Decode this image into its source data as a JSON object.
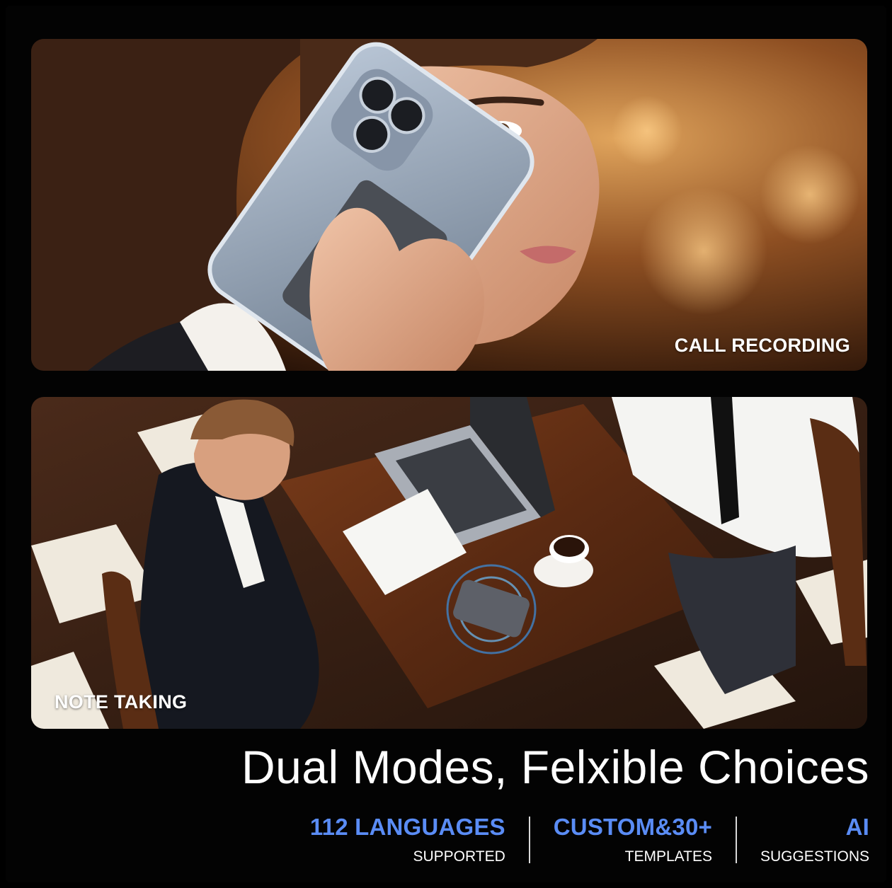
{
  "panels": {
    "top": {
      "label": "CALL RECORDING"
    },
    "bottom": {
      "label": "NOTE TAKING"
    }
  },
  "headline": "Dual Modes, Felxible Choices",
  "stats": [
    {
      "value": "112 LANGUAGES",
      "sub": "SUPPORTED"
    },
    {
      "value": "CUSTOM&30+",
      "sub": "TEMPLATES"
    },
    {
      "value": "AI",
      "sub": "SUGGESTIONS"
    }
  ],
  "colors": {
    "accent": "#5a8cf5",
    "background": "#000000",
    "text": "#ffffff"
  }
}
